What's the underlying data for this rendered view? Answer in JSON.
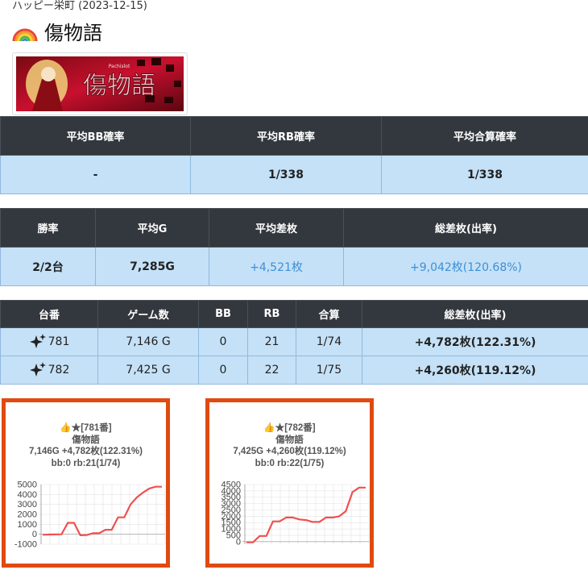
{
  "header": {
    "breadcrumb": "ハッピー栄町 (2023-12-15)",
    "title": "傷物語",
    "title_icon": "rainbow-icon"
  },
  "banner": {
    "main_text": "傷物語",
    "sub_text": "Pachislot",
    "brand_color": "#c8102e"
  },
  "summary1": {
    "headers": [
      "平均BB確率",
      "平均RB確率",
      "平均合算確率"
    ],
    "values": [
      "-",
      "1/338",
      "1/338"
    ]
  },
  "summary2": {
    "headers": [
      "勝率",
      "平均G",
      "平均差枚",
      "総差枚(出率)"
    ],
    "values": [
      "2/2台",
      "7,285G",
      "+4,521枚",
      "+9,042枚(120.68%)"
    ]
  },
  "machines": {
    "headers": [
      "台番",
      "ゲーム数",
      "BB",
      "RB",
      "合算",
      "総差枚(出率)"
    ],
    "rows": [
      {
        "number": "781",
        "games": "7,146 G",
        "bb": "0",
        "rb": "21",
        "total": "1/74",
        "diff": "+4,782枚(122.31%)"
      },
      {
        "number": "782",
        "games": "7,425 G",
        "bb": "0",
        "rb": "22",
        "total": "1/75",
        "diff": "+4,260枚(119.12%)"
      }
    ]
  },
  "cards": [
    {
      "line1": "👍★[781番]",
      "line2": "傷物語",
      "line3": "7,146G +4,782枚(122.31%)",
      "line4": "bb:0 rb:21(1/74)",
      "yticks": [
        "5000",
        "4000",
        "3000",
        "2000",
        "1000",
        "0",
        "-1000"
      ],
      "chart_data": {
        "type": "line",
        "ylim": [
          -1000,
          5000
        ],
        "yticks": [
          5000,
          4000,
          3000,
          2000,
          1000,
          0,
          -1000
        ],
        "color": "#f05050",
        "values": [
          -50,
          -30,
          -20,
          0,
          1150,
          1150,
          -100,
          -80,
          100,
          100,
          450,
          450,
          1700,
          1700,
          3000,
          3700,
          4200,
          4600,
          4782,
          4782
        ]
      }
    },
    {
      "line1": "👍★[782番]",
      "line2": "傷物語",
      "line3": "7,425G +4,260枚(119.12%)",
      "line4": "bb:0 rb:22(1/75)",
      "yticks": [
        "4500",
        "4000",
        "3500",
        "3000",
        "2500",
        "2000",
        "1500",
        "1000",
        "500",
        "0"
      ],
      "chart_data": {
        "type": "line",
        "ylim": [
          -200,
          4500
        ],
        "yticks": [
          4500,
          4000,
          3500,
          3000,
          2500,
          2000,
          1500,
          1000,
          500,
          0
        ],
        "color": "#f05050",
        "values": [
          -50,
          -50,
          450,
          450,
          1600,
          1600,
          1900,
          1900,
          1750,
          1700,
          1550,
          1550,
          1900,
          1900,
          2000,
          2400,
          3900,
          4260,
          4260
        ]
      }
    }
  ]
}
